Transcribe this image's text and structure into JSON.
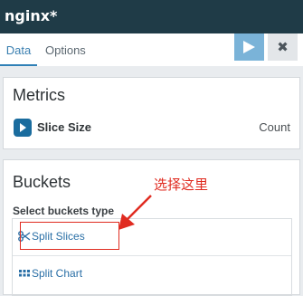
{
  "window": {
    "title": "nginx*"
  },
  "tabs": [
    {
      "label": "Data",
      "active": true
    },
    {
      "label": "Options",
      "active": false
    }
  ],
  "toolbar": {
    "apply_icon": "play-icon",
    "close_icon": "close-icon",
    "close_glyph": "✖"
  },
  "metrics": {
    "title": "Metrics",
    "aggregation": {
      "label": "Slice Size",
      "value": "Count",
      "icon": "caret-right-icon"
    }
  },
  "buckets": {
    "title": "Buckets",
    "select_label": "Select buckets type",
    "options": [
      {
        "label": "Split Slices",
        "icon": "scissors-icon"
      },
      {
        "label": "Split Chart",
        "icon": "grid-icon"
      }
    ]
  },
  "annotation": {
    "text": "选择这里",
    "color": "#e02b20"
  },
  "colors": {
    "titlebar": "#1f3b47",
    "accent": "#2f80b6",
    "play_button": "#7ab3d8",
    "link": "#2a6fa6"
  }
}
